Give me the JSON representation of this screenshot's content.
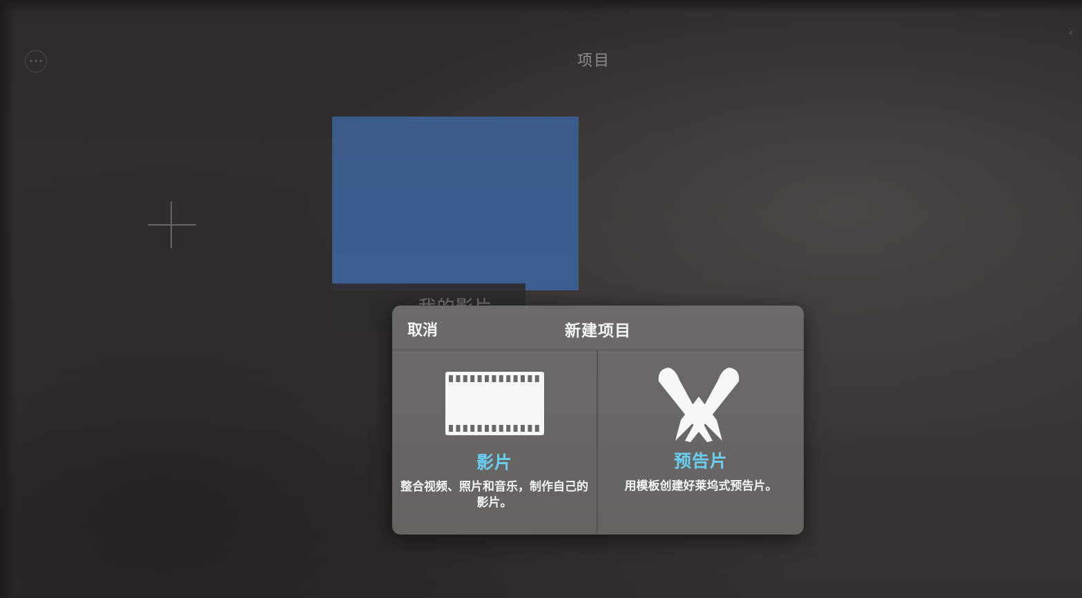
{
  "header": {
    "title": "项目",
    "more_icon": "ellipsis-circle-icon",
    "more_glyph": "•••",
    "edge_icon": "chevron-left-icon",
    "edge_glyph": "‹"
  },
  "projects": {
    "add_icon": "plus-icon",
    "items": [
      {
        "label": "我的影片",
        "thumb_color": "#3b5b8a"
      }
    ]
  },
  "dialog": {
    "cancel_label": "取消",
    "title": "新建项目",
    "options": [
      {
        "name": "影片",
        "icon": "film-strip-icon",
        "description": "整合视频、照片和音乐，制作自己的影片。"
      },
      {
        "name": "预告片",
        "icon": "searchlights-icon",
        "description": "用模板创建好莱坞式预告片。"
      }
    ]
  },
  "colors": {
    "accent": "#68cff2",
    "dialog_bg": "#6a6866",
    "background": "#2f2d2c"
  }
}
